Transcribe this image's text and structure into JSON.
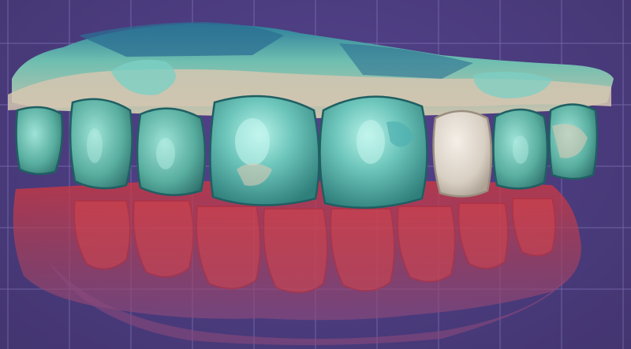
{
  "viewport": {
    "background_color": "#4a3b7d",
    "grid_color": "#8f86c9",
    "grid_visible": true
  },
  "model": {
    "upper_arch_color": "#7ccfc4",
    "gingiva_color": "#d9c9b5",
    "scan_edge_color": "#2b7d9a",
    "lower_arch_color": "#c2384a",
    "lower_tissue_color": "#9b4d79",
    "wax_up_tooth_color": "#e6ddd2"
  }
}
